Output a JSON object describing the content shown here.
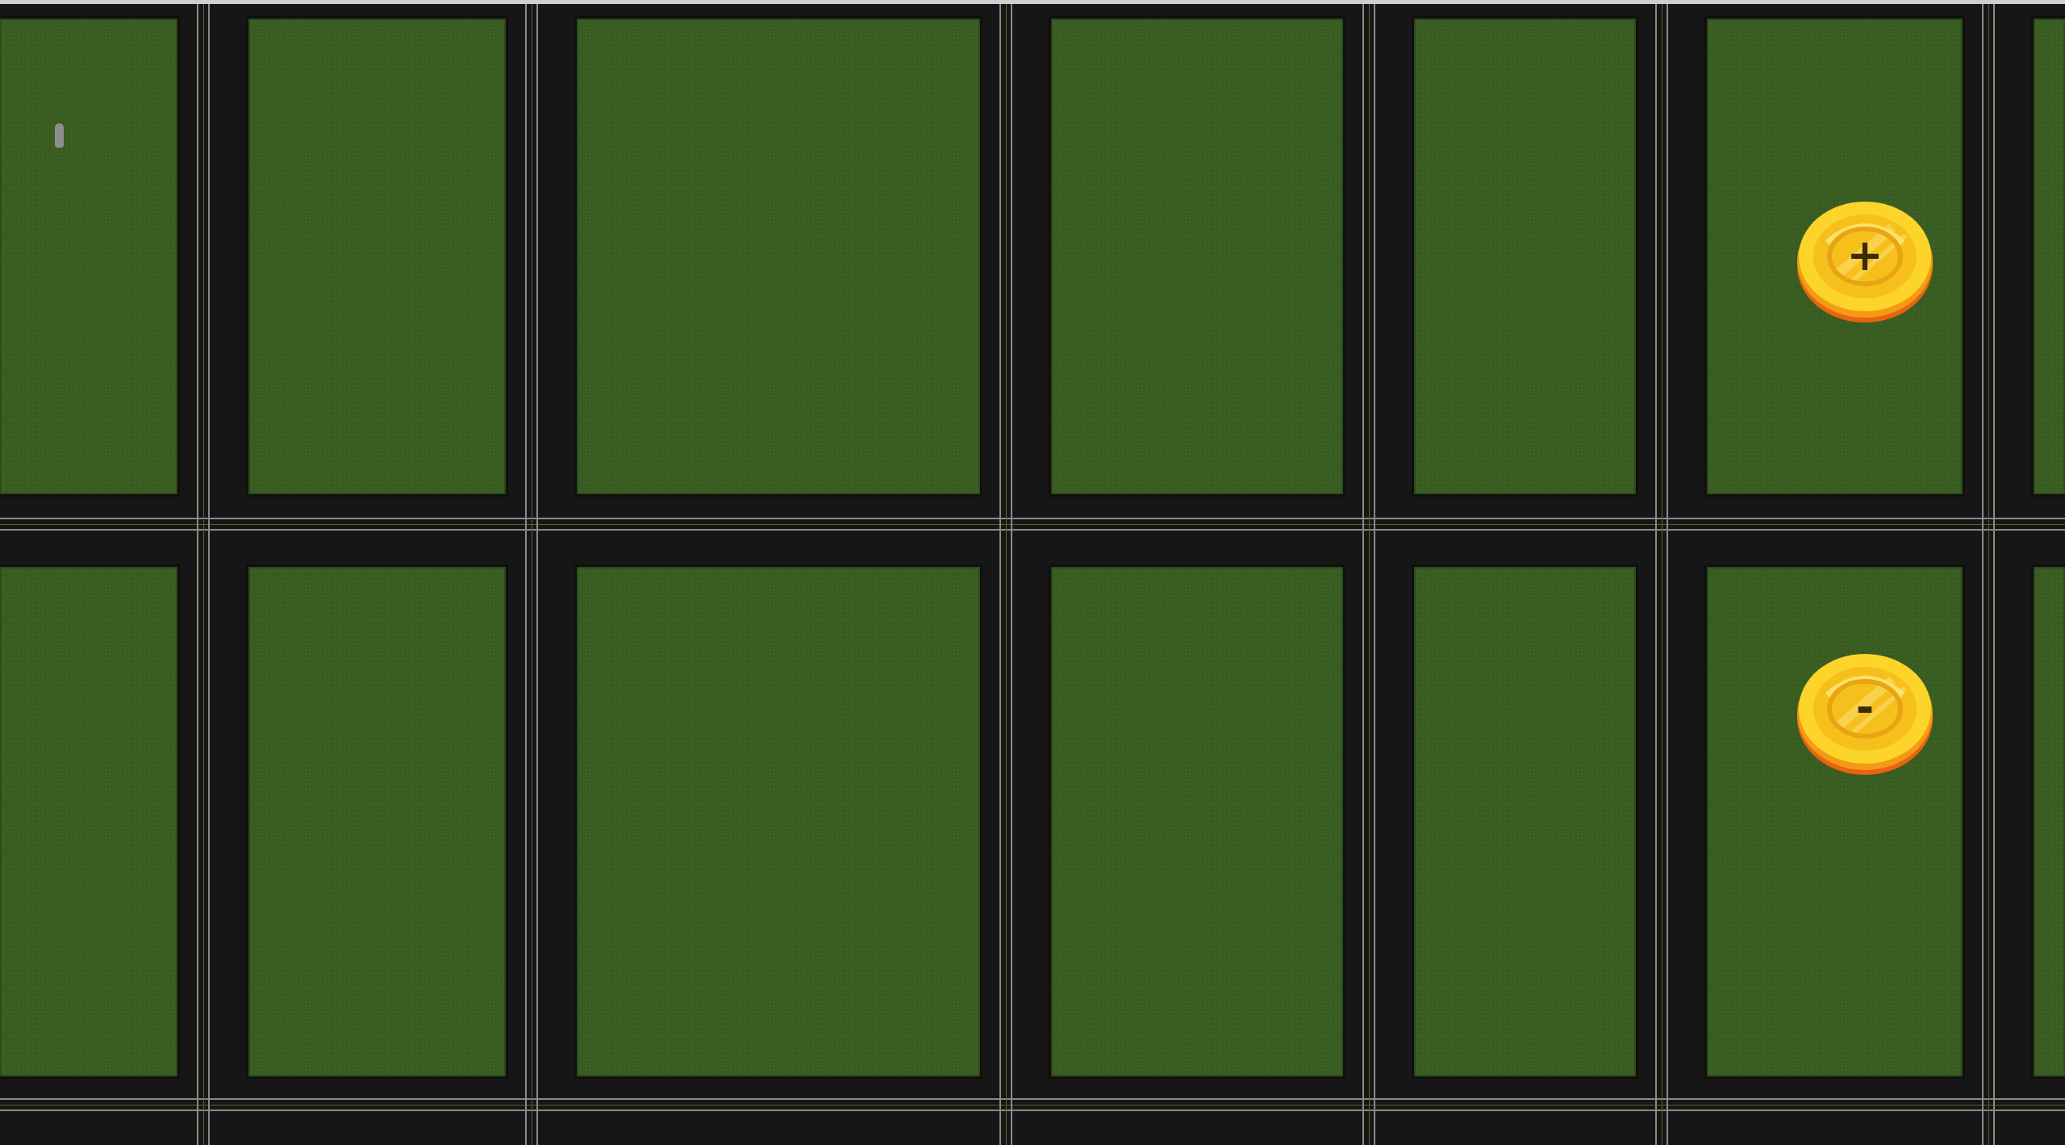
{
  "map": {
    "grass_color": "#3a5e22",
    "road_color": "#161616",
    "marker_color": "#8e8e8e"
  },
  "zoom_controls": {
    "zoom_in_label": "+",
    "zoom_out_label": "-",
    "coin_color": "#f7c21b",
    "coin_rim_color": "#f07c12"
  }
}
